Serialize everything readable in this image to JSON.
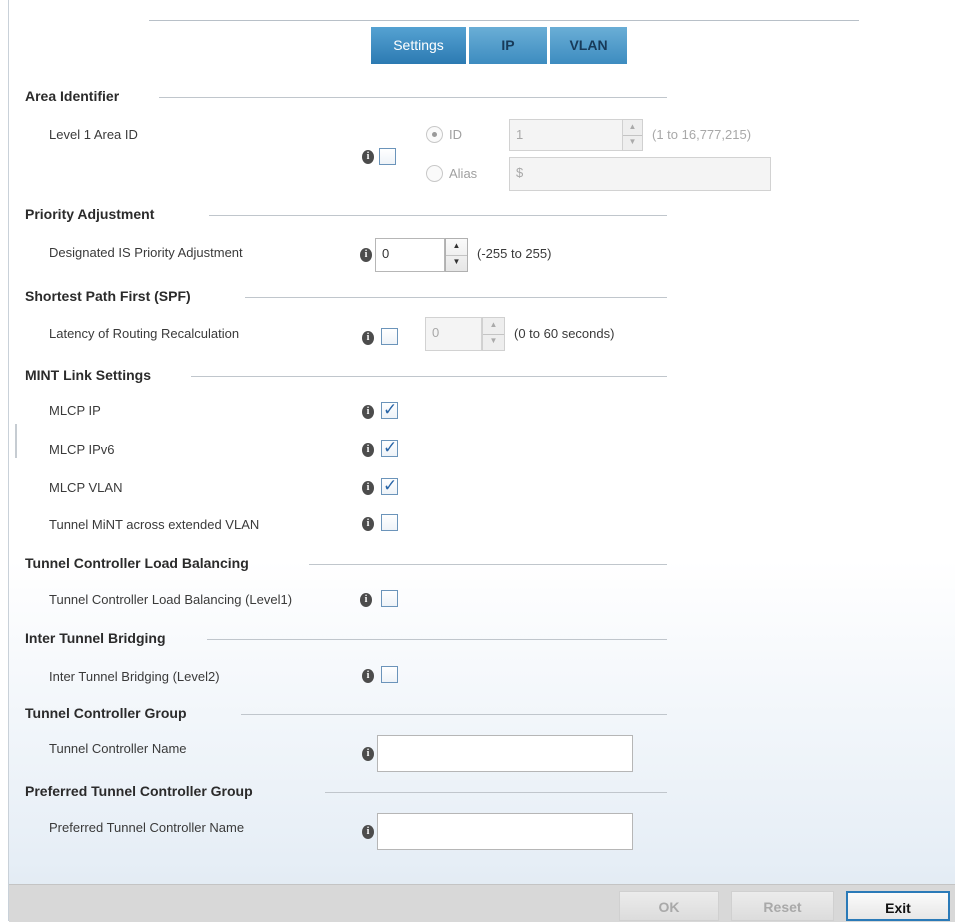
{
  "tabs": [
    {
      "label": "Settings",
      "active": true
    },
    {
      "label": "IP",
      "active": false
    },
    {
      "label": "VLAN",
      "active": false
    }
  ],
  "area_identifier": {
    "title": "Area Identifier",
    "level1_label": "Level 1 Area ID",
    "enabled": false,
    "radio_id_label": "ID",
    "radio_id_selected": true,
    "radio_alias_label": "Alias",
    "id_value": "1",
    "id_range": "(1 to 16,777,215)",
    "alias_value": "$"
  },
  "priority_adjustment": {
    "title": "Priority Adjustment",
    "label": "Designated IS Priority Adjustment",
    "value": "0",
    "range": "(-255 to 255)"
  },
  "spf": {
    "title": "Shortest Path First (SPF)",
    "label": "Latency of Routing Recalculation",
    "enabled": false,
    "value": "0",
    "range": "(0 to 60 seconds)"
  },
  "mint_link": {
    "title": "MINT Link Settings",
    "items": [
      {
        "label": "MLCP IP",
        "checked": true
      },
      {
        "label": "MLCP IPv6",
        "checked": true
      },
      {
        "label": "MLCP VLAN",
        "checked": true
      },
      {
        "label": "Tunnel MiNT across extended VLAN",
        "checked": false
      }
    ]
  },
  "load_balancing": {
    "title": "Tunnel Controller Load Balancing",
    "label": "Tunnel Controller Load Balancing (Level1)",
    "checked": false
  },
  "inter_tunnel": {
    "title": "Inter Tunnel Bridging",
    "label": "Inter Tunnel Bridging (Level2)",
    "checked": false
  },
  "controller_group": {
    "title": "Tunnel Controller Group",
    "label": "Tunnel Controller Name",
    "value": ""
  },
  "preferred_group": {
    "title": "Preferred Tunnel Controller Group",
    "label": "Preferred Tunnel Controller Name",
    "value": ""
  },
  "footer": {
    "ok_label": "OK",
    "reset_label": "Reset",
    "exit_label": "Exit"
  },
  "icons": {
    "info": "info-icon",
    "check": "checkmark-icon",
    "spin_up": "spin-up-icon",
    "spin_down": "spin-down-icon"
  },
  "colors": {
    "tab_active": "#2c7ab2",
    "tab_inactive": "#3d8cc0",
    "checkbox_border": "#6b94ba",
    "exit_border": "#2a7ab8"
  }
}
